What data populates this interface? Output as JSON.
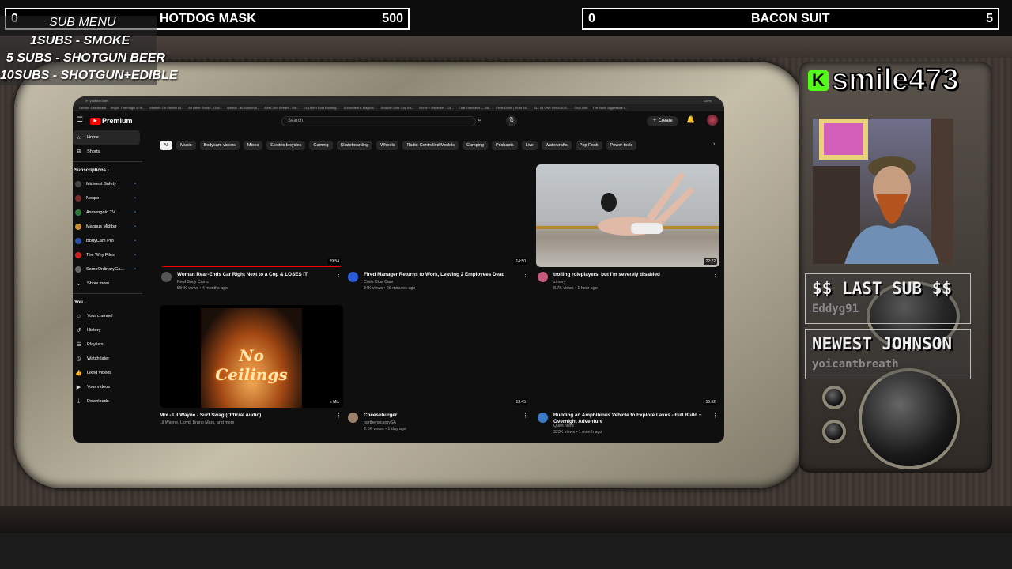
{
  "goal_bar_left": {
    "current": "0",
    "title": "HOTDOG MASK",
    "target": "500"
  },
  "goal_bar_right": {
    "current": "0",
    "title": "BACON SUIT",
    "target": "5"
  },
  "sub_menu": {
    "title": "SUB MENU",
    "items": [
      "1SUBS   - SMOKE",
      "5 SUBS  - SHOTGUN BEER",
      "10SUBS - SHOTGUN+EDIBLE"
    ]
  },
  "streamer": {
    "platform_logo": "K",
    "name": "smile473"
  },
  "last_sub": {
    "label": "$$ LAST SUB $$",
    "name": "Eddyg91"
  },
  "newest_johnson": {
    "label": "NEWEST JOHNSON",
    "name": "yoicantbreath"
  },
  "browser": {
    "url": "youtube.com",
    "zoom": "150%",
    "bookmarks": [
      "Creator Dashboard",
      "Imgur: The magic of th...",
      "Markets On Stream Ui...",
      "All Other Tracks - Goo...",
      "GitHub - ac-custom-s...",
      "AixeC399 Stream - Wa...",
      "ECORWI Boat Building...",
      "A Wonderful, Magical...",
      "Amazon.com: Log Ins...",
      "VERIFE Repeater - Ca...",
      "Chat Translator — Ad...",
      "FreshDoom | Rust Bo...",
      "ALL IN ONE PACKAGE...",
      "Club.com",
      "The Vault: Aggressive l..."
    ]
  },
  "youtube": {
    "logo": "Premium",
    "search_placeholder": "Search",
    "create_label": "Create",
    "sidebar": {
      "home": "Home",
      "shorts": "Shorts",
      "subscriptions_heading": "Subscriptions",
      "subscriptions": [
        "Midwest Safety",
        "Nexpo",
        "Asmongold TV",
        "Magnus Midtbø",
        "BodyCam Pro",
        "The Why Files",
        "SomeOrdinaryGa..."
      ],
      "show_more": "Show more",
      "you_heading": "You",
      "you_items": [
        "Your channel",
        "History",
        "Playlists",
        "Watch later",
        "Liked videos",
        "Your videos",
        "Downloads"
      ]
    },
    "chips": [
      "All",
      "Music",
      "Bodycam videos",
      "Mixes",
      "Electric bicycles",
      "Gaming",
      "Skateboarding",
      "Wheels",
      "Radio-Controlled Models",
      "Camping",
      "Podcasts",
      "Live",
      "Watercrafts",
      "Pop Rock",
      "Power tools"
    ],
    "videos": [
      {
        "title": "Woman Rear-Ends Car Right Next to a Cop & LOSES IT",
        "channel": "Real Body Cams",
        "meta": "584K views • 4 months ago",
        "duration": "29:54",
        "watched": 1.0
      },
      {
        "title": "Fired Manager Returns to Work, Leaving 2 Employees Dead",
        "channel": "Code Blue Cam",
        "meta": "34K views • 56 minutes ago",
        "duration": "14:50"
      },
      {
        "title": "trolling roleplayers, but I'm severely disabled",
        "channel": "zimery",
        "meta": "8.7K views • 1 hour ago",
        "duration": "22:22"
      },
      {
        "title": "Mix - Lil Wayne - Surf Swag (Official Audio)",
        "channel": "Lil Wayne, Lloyd, Bruno Mars, and more",
        "meta": "",
        "duration": "Mix",
        "album_text": "No Ceilings"
      },
      {
        "title": "Cheeseburger",
        "channel": "parthenocarpySA",
        "meta": "2.1K views • 1 day ago",
        "duration": "13:45"
      },
      {
        "title": "Building an Amphibious Vehicle to Explore Lakes - Full Build + Overnight Adventure",
        "channel": "Quiet Nerd",
        "meta": "323K views • 1 month ago",
        "duration": "56:52"
      }
    ]
  }
}
